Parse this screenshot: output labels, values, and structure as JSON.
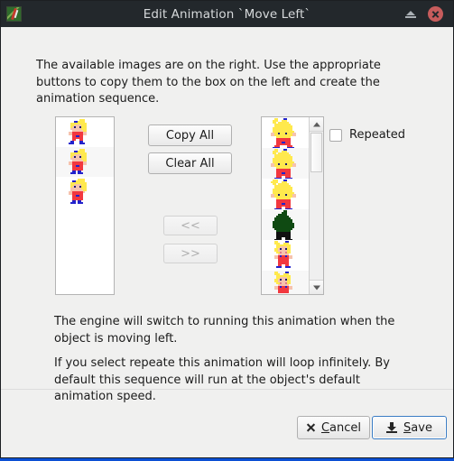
{
  "window": {
    "title": "Edit Animation `Move Left`",
    "app_icon": "app-pixel-icon",
    "shade_icon": "shade-window-icon",
    "close_icon": "close-window-icon"
  },
  "instructions": {
    "intro": "The available images are on the right. Use the appropriate buttons to copy them to the box on the left and create the animation sequence.",
    "desc_1": "The engine will switch to running this animation when the object is moving left.",
    "desc_2": "If you select repeate this animation will loop infinitely. By default this sequence will run at the object's default animation speed."
  },
  "sequence_list": {
    "name": "animation-sequence-list",
    "frames": [
      {
        "label": "frame-girl-run-1",
        "type": "girl-red"
      },
      {
        "label": "frame-girl-run-2",
        "type": "girl-red"
      },
      {
        "label": "frame-girl-run-3",
        "type": "girl-red"
      }
    ]
  },
  "available_list": {
    "name": "available-images-list",
    "frames": [
      {
        "label": "image-blonde-big-1",
        "type": "blonde-big"
      },
      {
        "label": "image-blonde-big-2",
        "type": "blonde-big"
      },
      {
        "label": "image-blonde-big-3",
        "type": "blonde-big"
      },
      {
        "label": "image-bush-green",
        "type": "bush"
      },
      {
        "label": "image-girl-overalls-1",
        "type": "girl-overalls"
      },
      {
        "label": "image-girl-overalls-2",
        "type": "girl-overalls"
      }
    ],
    "scrollbar": {
      "up_icon": "scroll-up-arrow-icon",
      "down_icon": "scroll-down-arrow-icon"
    }
  },
  "buttons": {
    "copy_all": "Copy All",
    "clear_all": "Clear All",
    "move_left": "<<",
    "move_right": ">>",
    "move_left_enabled": false,
    "move_right_enabled": false
  },
  "options": {
    "repeated_label": "Repeated",
    "repeated_checked": false
  },
  "footer": {
    "cancel": {
      "prefix": "",
      "mnemonic": "C",
      "suffix": "ancel",
      "icon": "cancel-x-icon"
    },
    "save": {
      "prefix": "",
      "mnemonic": "S",
      "suffix": "ave",
      "icon": "save-download-icon"
    }
  },
  "colors": {
    "titlebar": "#23282c",
    "close": "#c75c5c",
    "dialog_bg": "#f0f0ef",
    "accent_focus": "#3a7cc4",
    "desktop": "#0b4fd4"
  }
}
